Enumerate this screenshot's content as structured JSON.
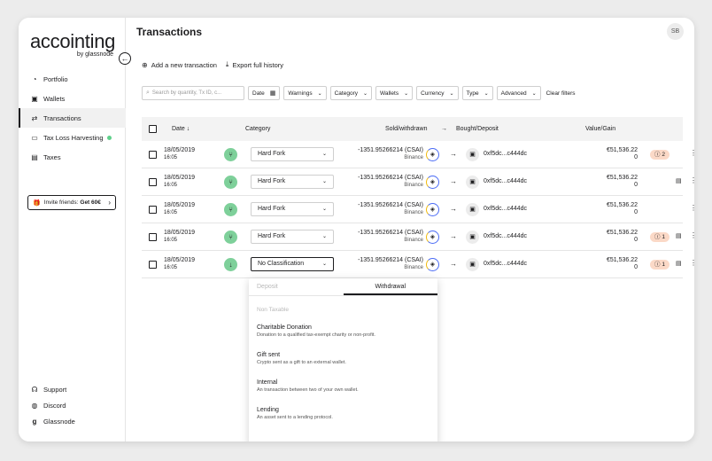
{
  "sidebar": {
    "logo_main": "accointing",
    "logo_sub": "by glassnode",
    "items": [
      {
        "label": "Portfolio",
        "icon": "portfolio-icon"
      },
      {
        "label": "Wallets",
        "icon": "wallet-icon"
      },
      {
        "label": "Transactions",
        "icon": "swap-icon"
      },
      {
        "label": "Tax Loss Harvesting",
        "icon": "harvest-icon"
      },
      {
        "label": "Taxes",
        "icon": "taxes-icon"
      }
    ],
    "invite_prefix": "Invite friends:",
    "invite_bold": "Get 60€",
    "bottom": [
      {
        "label": "Support"
      },
      {
        "label": "Discord"
      },
      {
        "label": "Glassnode"
      }
    ]
  },
  "header": {
    "title": "Transactions",
    "avatar": "SB"
  },
  "actions": {
    "add": "Add a new transaction",
    "export": "Export full history"
  },
  "filters": {
    "search_placeholder": "Search by quantity, Tx ID, c...",
    "buttons": [
      "Date",
      "Warnings",
      "Category",
      "Wallets",
      "Currency",
      "Type",
      "Advanced"
    ],
    "clear": "Clear filters"
  },
  "table": {
    "headers": {
      "date": "Date",
      "category": "Category",
      "sold": "Sold/withdrawn",
      "bought": "Bought/Deposit",
      "value": "Value/Gain"
    },
    "rows": [
      {
        "date": "18/05/2019",
        "time": "16:05",
        "category": "Hard Fork",
        "sold": "-1351.95266214 (CSAI)",
        "exchange": "Binance",
        "addr": "0xf5dc...c444dc",
        "value": "€51,536.22",
        "gain": "0",
        "badge": "2"
      },
      {
        "date": "18/05/2019",
        "time": "16:05",
        "category": "Hard Fork",
        "sold": "-1351.95266214 (CSAI)",
        "exchange": "Binance",
        "addr": "0xf5dc...c444dc",
        "value": "€51,536.22",
        "gain": "0",
        "badge": ""
      },
      {
        "date": "18/05/2019",
        "time": "16:05",
        "category": "Hard Fork",
        "sold": "-1351.95266214 (CSAI)",
        "exchange": "Binance",
        "addr": "0xf5dc...c444dc",
        "value": "€51,536.22",
        "gain": "0",
        "badge": ""
      },
      {
        "date": "18/05/2019",
        "time": "16:05",
        "category": "Hard Fork",
        "sold": "-1351.95266214 (CSAI)",
        "exchange": "Binance",
        "addr": "0xf5dc...c444dc",
        "value": "€51,536.22",
        "gain": "0",
        "badge": "1"
      },
      {
        "date": "18/05/2019",
        "time": "16:05",
        "category": "No Classification",
        "sold": "-1351.95266214 (CSAI)",
        "exchange": "Binance",
        "addr": "0xf5dc...c444dc",
        "value": "€51,536.22",
        "gain": "0",
        "badge": "1"
      }
    ]
  },
  "dropdown": {
    "tab_deposit": "Deposit",
    "tab_withdrawal": "Withdrawal",
    "section": "Non Taxable",
    "options": [
      {
        "name": "Charitable Donation",
        "desc": "Donation to a qualified tax-exempt charity or non-profit."
      },
      {
        "name": "Gift sent",
        "desc": "Crypto sent as a gift to an external wallet."
      },
      {
        "name": "Internal",
        "desc": "An transaction between two of your own wallet."
      },
      {
        "name": "Lending",
        "desc": "An asset sent to a lending protocol."
      }
    ]
  }
}
